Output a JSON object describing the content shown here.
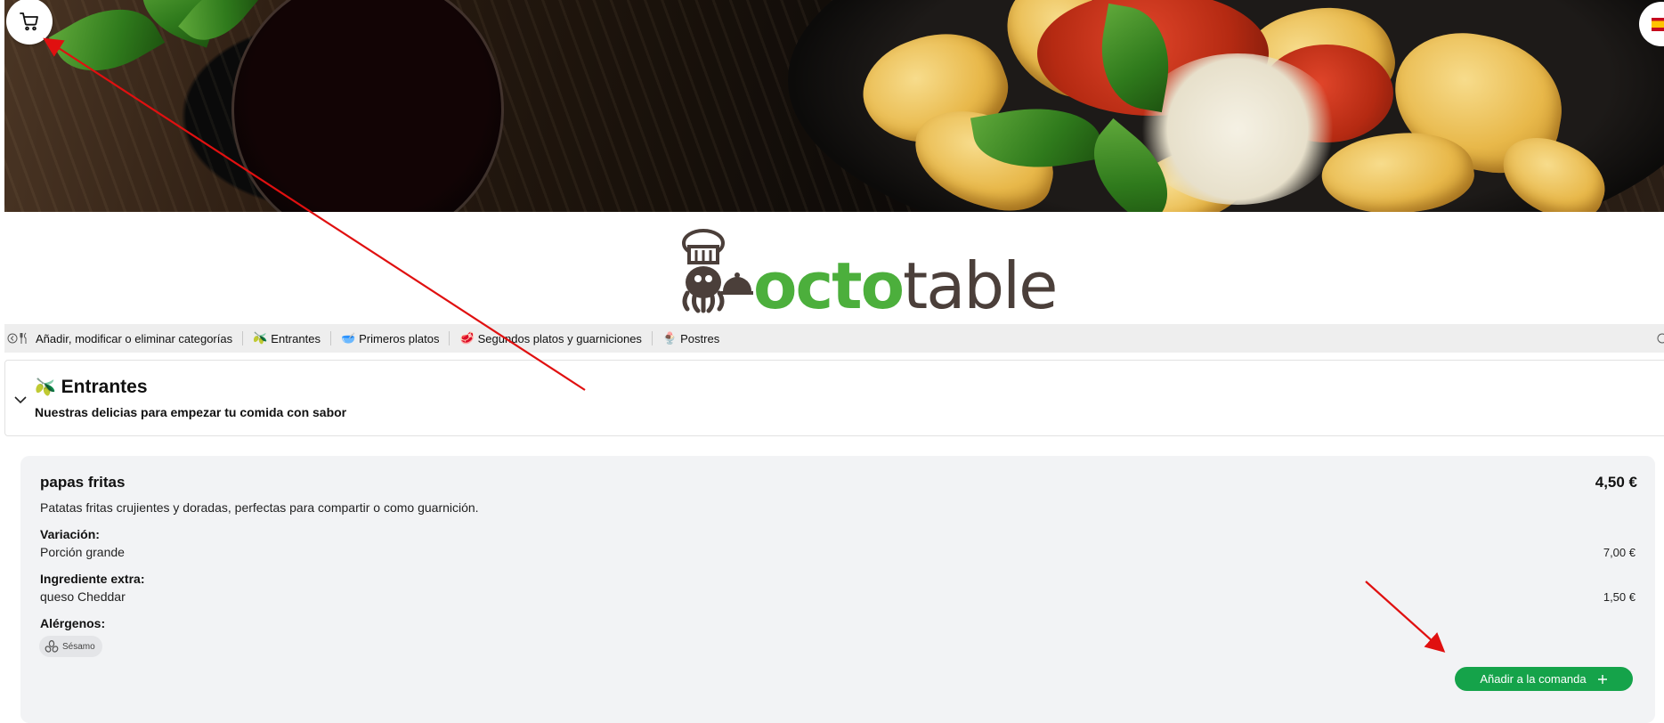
{
  "header": {
    "cart_icon": "shopping-cart-icon",
    "language_flag": "spain-flag-icon"
  },
  "logo": {
    "word_prefix": "octo",
    "word_suffix": "table",
    "brand_color": "#4caf3c",
    "text_color": "#4b3f3a"
  },
  "categories": {
    "scroll_left_icon": "chevron-left-circle-icon",
    "scroll_right_icon": "chevron-right-circle-icon",
    "manage": {
      "icon": "fork-knife-icon",
      "label": "Añadir, modificar o eliminar categorías"
    },
    "items": [
      {
        "emoji": "🫒",
        "label": "Entrantes"
      },
      {
        "emoji": "🥣",
        "label": "Primeros platos"
      },
      {
        "emoji": "🥩",
        "label": "Segundos platos y guarniciones"
      },
      {
        "emoji": "🍨",
        "label": "Postres"
      }
    ]
  },
  "section": {
    "emoji": "🫒",
    "title": "Entrantes",
    "subtitle": "Nuestras delicias para empezar tu comida con sabor"
  },
  "product": {
    "name": "papas fritas",
    "price": "4,50 €",
    "description": "Patatas fritas crujientes y doradas, perfectas para compartir o como guarnición.",
    "variation_label": "Variación:",
    "variation_name": "Porción grande",
    "variation_price": "7,00 €",
    "extra_label": "Ingrediente extra:",
    "extra_name": "queso Cheddar",
    "extra_price": "1,50 €",
    "allergens_label": "Alérgenos:",
    "allergens": [
      {
        "icon": "sesame-icon",
        "label": "Sésamo"
      }
    ],
    "add_button_label": "Añadir a la comanda",
    "add_button_color": "#15a34a"
  },
  "annotations": {
    "arrow_color": "#e01010"
  }
}
